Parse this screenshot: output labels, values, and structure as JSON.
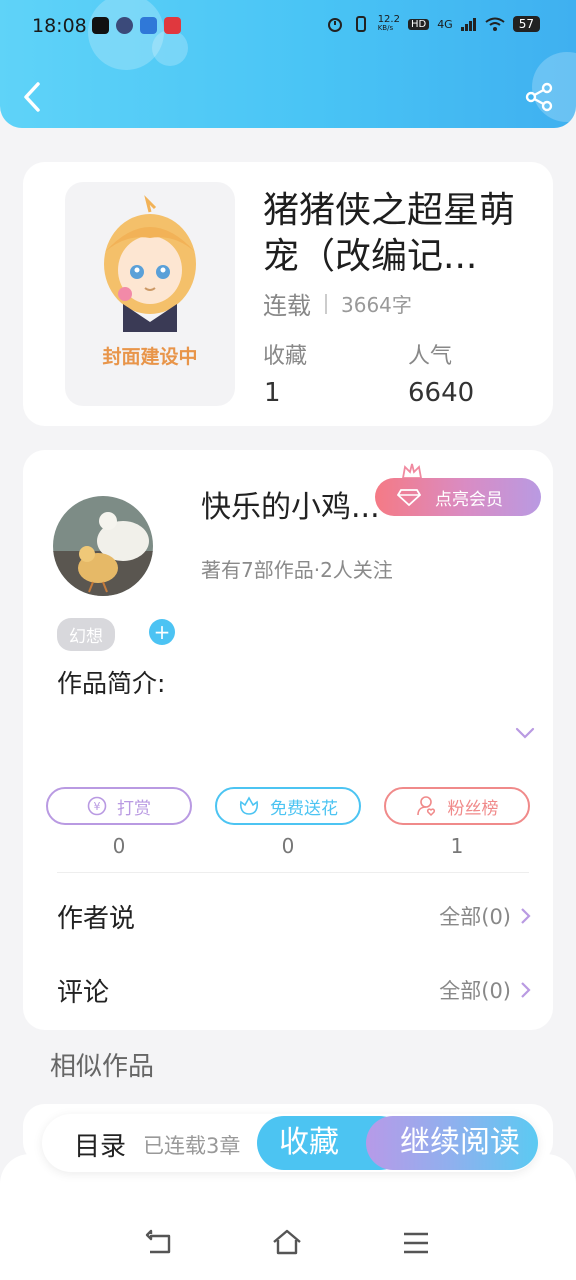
{
  "status_bar": {
    "time": "18:08",
    "net_speed": "12.2",
    "net_unit": "KB/s",
    "hd": "HD",
    "signal": "4G",
    "battery": "57"
  },
  "book": {
    "title": "猪猪侠之超星萌宠（改编记...",
    "cover_label": "封面建设中",
    "status": "连载",
    "words": "3664字",
    "favorites_label": "收藏",
    "favorites_value": "1",
    "popularity_label": "人气",
    "popularity_value": "6640"
  },
  "author": {
    "name": "快乐的小鸡...",
    "vip_label": "点亮会员",
    "stats": "著有7部作品·2人关注",
    "tag": "幻想",
    "add_tag": "+",
    "intro_label": "作品简介:"
  },
  "actions": [
    {
      "label": "打赏",
      "count": "0",
      "color": "#b99ae2",
      "icon": "yuan-coin-icon"
    },
    {
      "label": "免费送花",
      "count": "0",
      "color": "#4cc4f2",
      "icon": "flower-icon"
    },
    {
      "label": "粉丝榜",
      "count": "1",
      "color": "#f08a8a",
      "icon": "fan-user-icon"
    }
  ],
  "rows": {
    "author_says": {
      "title": "作者说",
      "right": "全部(0)"
    },
    "comments": {
      "title": "评论",
      "right": "全部(0)"
    }
  },
  "similar_label": "相似作品",
  "bottom_bar": {
    "toc_label": "目录",
    "toc_sub": "已连载3章",
    "favorite_button": "收藏",
    "continue_button": "继续阅读"
  },
  "colors": {
    "header_gradient_start": "#5fd3f8",
    "header_gradient_end": "#3fb0f0",
    "accent_blue": "#4cc4f2",
    "accent_purple": "#b99ae2",
    "accent_red": "#f08a8a"
  }
}
